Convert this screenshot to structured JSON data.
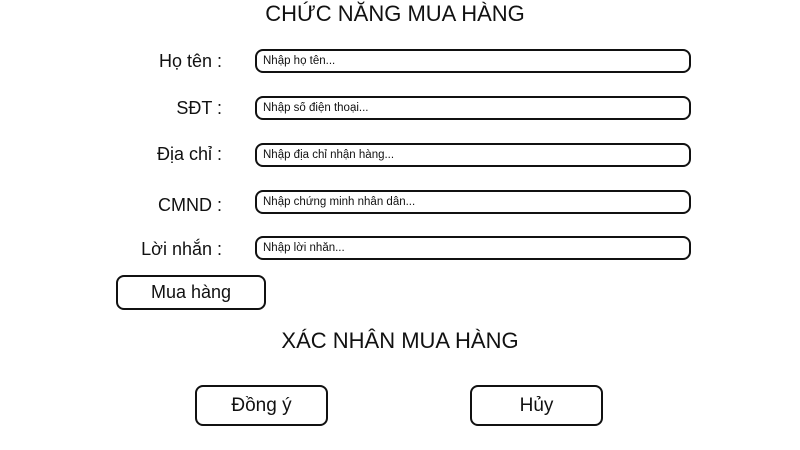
{
  "purchase_form": {
    "title": "CHỨC NĂNG MUA HÀNG",
    "fields": [
      {
        "label": "Họ tên :",
        "placeholder": "Nhập họ tên..."
      },
      {
        "label": "SĐT :",
        "placeholder": "Nhập số điện thoại..."
      },
      {
        "label": "Địa chỉ :",
        "placeholder": "Nhập địa chỉ nhận hàng..."
      },
      {
        "label": "CMND :",
        "placeholder": "Nhập chứng minh nhân dân..."
      },
      {
        "label": "Lời nhắn :",
        "placeholder": "Nhập lời nhắn..."
      }
    ],
    "submit_label": "Mua hàng"
  },
  "confirm": {
    "title": "XÁC NHÂN MUA HÀNG",
    "agree_label": "Đồng ý",
    "cancel_label": "Hủy"
  }
}
